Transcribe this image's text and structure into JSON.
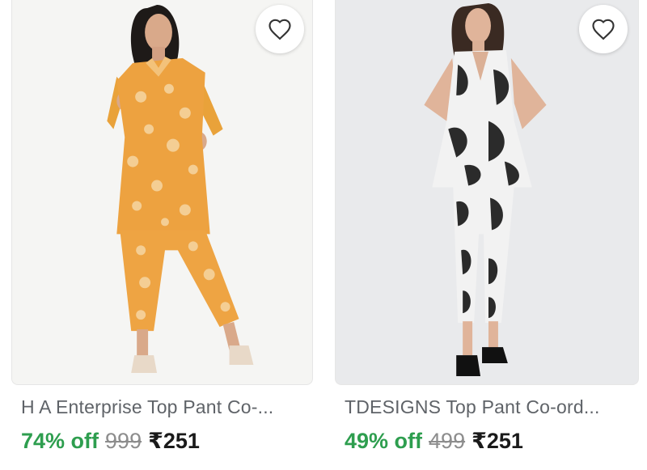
{
  "products": [
    {
      "title": "H A Enterprise Top Pant Co-...",
      "discount": "74% off",
      "mrp": "999",
      "price": "₹251",
      "wishlist_icon": "heart-outline-icon"
    },
    {
      "title": "TDESIGNS Top Pant Co-ord...",
      "discount": "49% off",
      "mrp": "499",
      "price": "₹251",
      "wishlist_icon": "heart-outline-icon"
    }
  ],
  "colors": {
    "discount": "#2e9e4f",
    "title": "#5f6368",
    "mrp": "#8d8d8d",
    "price": "#1a1a1a"
  }
}
